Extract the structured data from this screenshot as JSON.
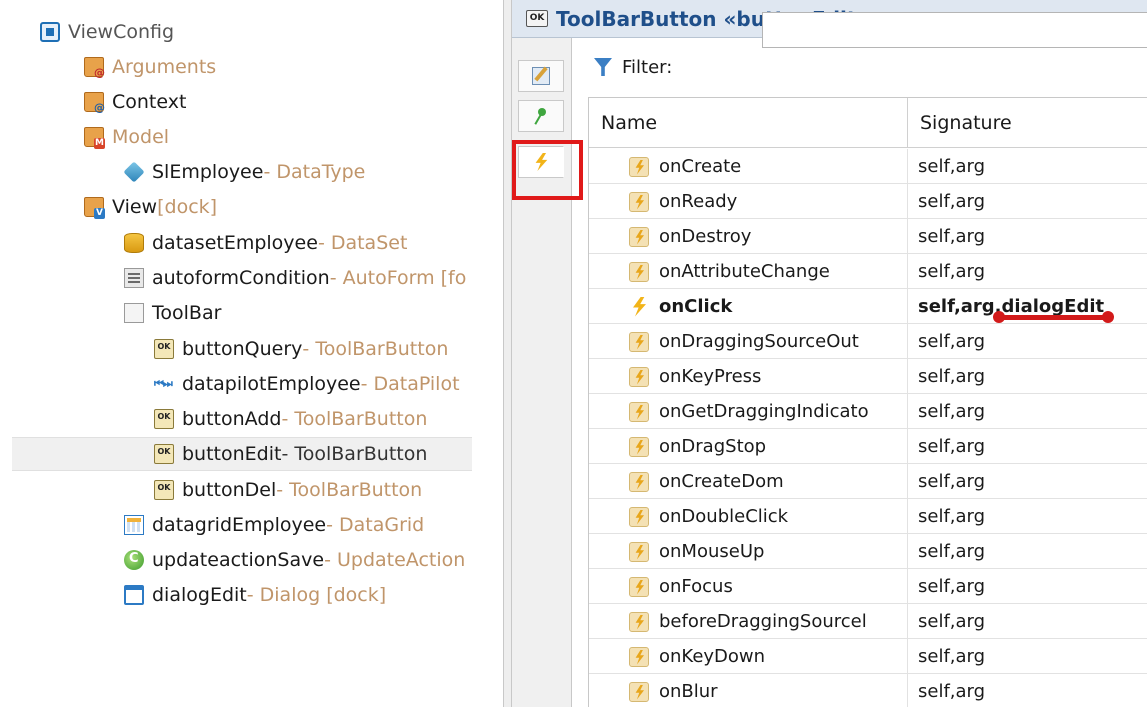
{
  "tree": {
    "root": {
      "label": "ViewConfig"
    },
    "items": [
      {
        "label": "Arguments",
        "type": ""
      },
      {
        "label": "Context",
        "type": ""
      },
      {
        "label": "Model",
        "type": ""
      },
      {
        "label": "SlEmployee",
        "type": " - DataType"
      },
      {
        "label": "View",
        "type": " [dock]"
      },
      {
        "label": "datasetEmployee",
        "type": " - DataSet"
      },
      {
        "label": "autoformCondition",
        "type": " - AutoForm [fo"
      },
      {
        "label": "ToolBar",
        "type": ""
      },
      {
        "label": "buttonQuery",
        "type": " - ToolBarButton"
      },
      {
        "label": "datapilotEmployee",
        "type": " - DataPilot"
      },
      {
        "label": "buttonAdd",
        "type": " - ToolBarButton"
      },
      {
        "label": "buttonEdit",
        "type": " - ToolBarButton"
      },
      {
        "label": "buttonDel",
        "type": " - ToolBarButton"
      },
      {
        "label": "datagridEmployee",
        "type": " - DataGrid"
      },
      {
        "label": "updateactionSave",
        "type": " - UpdateAction"
      },
      {
        "label": "dialogEdit",
        "type": " - Dialog [dock]"
      }
    ]
  },
  "editor": {
    "title": "ToolBarButton «buttonEdit»",
    "icon_text": "OK",
    "filter_label": "Filter:",
    "filter_value": "",
    "columns": [
      "Name",
      "Signature"
    ],
    "events": [
      {
        "name": "onCreate",
        "signature": "self,arg"
      },
      {
        "name": "onReady",
        "signature": "self,arg"
      },
      {
        "name": "onDestroy",
        "signature": "self,arg"
      },
      {
        "name": "onAttributeChange",
        "signature": "self,arg"
      },
      {
        "name": "onClick",
        "signature": "self,arg,dialogEdit"
      },
      {
        "name": "onDraggingSourceOut",
        "signature": "self,arg"
      },
      {
        "name": "onKeyPress",
        "signature": "self,arg"
      },
      {
        "name": "onGetDraggingIndicato",
        "signature": "self,arg"
      },
      {
        "name": "onDragStop",
        "signature": "self,arg"
      },
      {
        "name": "onCreateDom",
        "signature": "self,arg"
      },
      {
        "name": "onDoubleClick",
        "signature": "self,arg"
      },
      {
        "name": "onMouseUp",
        "signature": "self,arg"
      },
      {
        "name": "onFocus",
        "signature": "self,arg"
      },
      {
        "name": "beforeDraggingSourcel",
        "signature": "self,arg"
      },
      {
        "name": "onKeyDown",
        "signature": "self,arg"
      },
      {
        "name": "onBlur",
        "signature": "self,arg"
      }
    ]
  },
  "colors": {
    "accent": "#1f4f8a",
    "type_label": "#c0956a",
    "annotation_red": "#e01919"
  }
}
